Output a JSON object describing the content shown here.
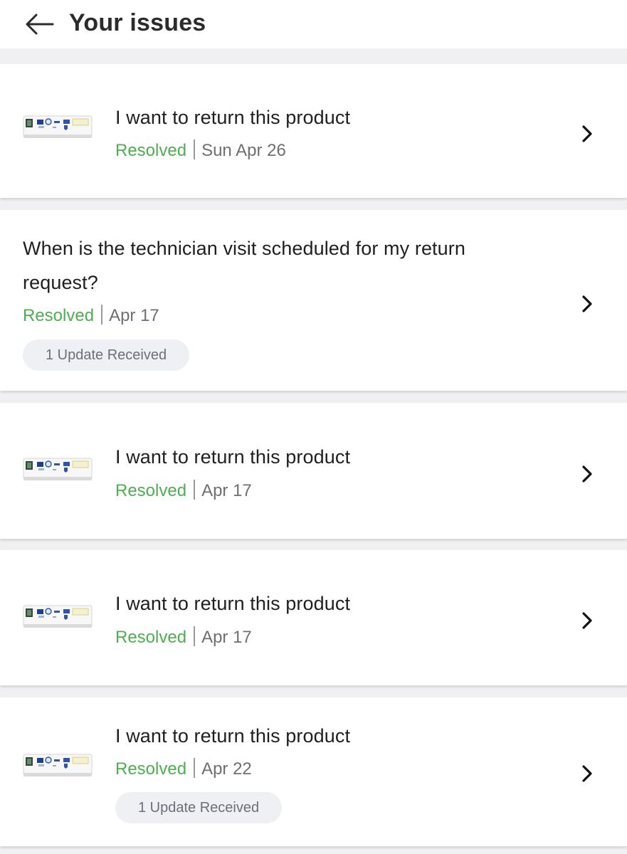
{
  "header": {
    "title": "Your issues",
    "back_icon": "arrow-left-icon"
  },
  "colors": {
    "resolved": "#4caf50",
    "date": "#6f6f6f",
    "pill_bg": "#eef0f4"
  },
  "issues": [
    {
      "title": "I want to return this product",
      "status": "Resolved",
      "date": "Sun Apr 26",
      "has_thumbnail": true,
      "update": ""
    },
    {
      "title_line1": "When is the technician visit scheduled for my return",
      "title_line2": "request?",
      "status": "Resolved",
      "date": "Apr 17",
      "has_thumbnail": false,
      "update": "1 Update Received"
    },
    {
      "title": "I want to return this product",
      "status": "Resolved",
      "date": "Apr 17",
      "has_thumbnail": true,
      "update": ""
    },
    {
      "title": "I want to return this product",
      "status": "Resolved",
      "date": "Apr 17",
      "has_thumbnail": true,
      "update": ""
    },
    {
      "title": "I want to return this product",
      "status": "Resolved",
      "date": "Apr 22",
      "has_thumbnail": true,
      "update": "1 Update Received"
    }
  ]
}
